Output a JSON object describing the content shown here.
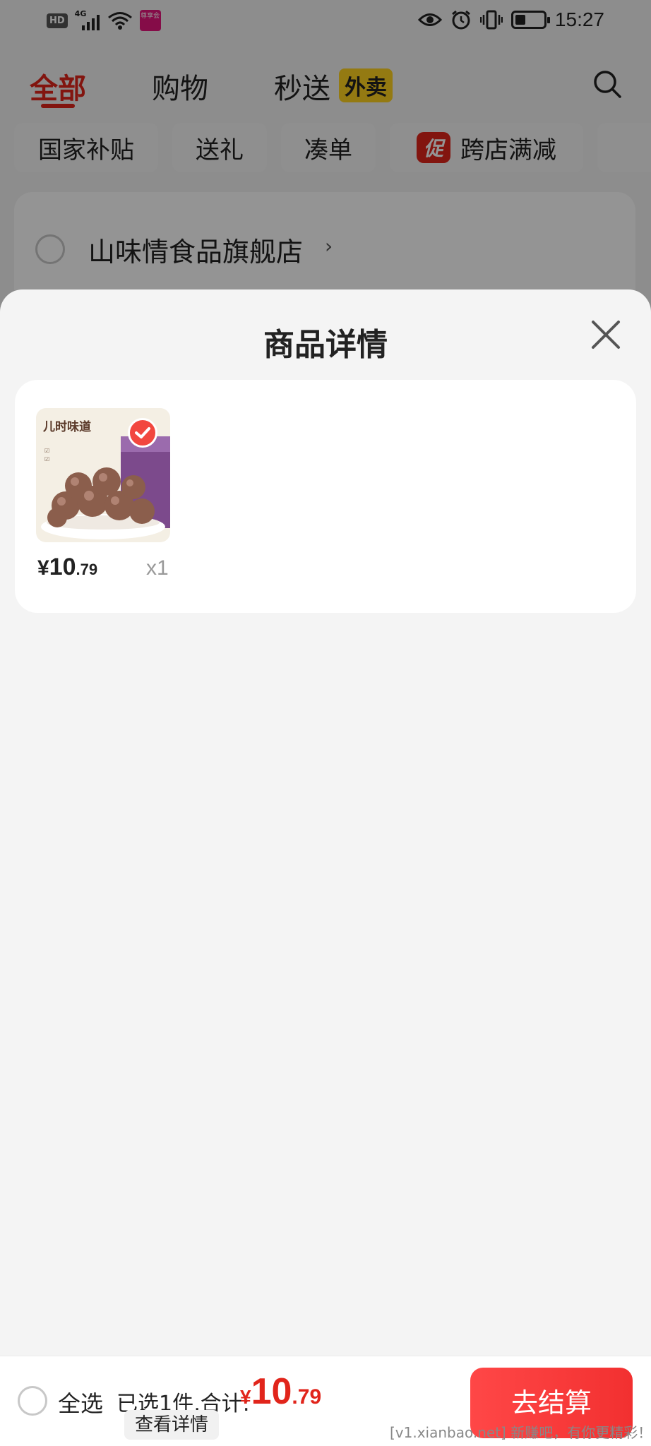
{
  "status_bar": {
    "hd": "HD",
    "network": "4G",
    "notification_app": "尊享会",
    "time": "15:27"
  },
  "top_tabs": [
    {
      "label": "全部",
      "active": true
    },
    {
      "label": "购物",
      "active": false
    },
    {
      "label": "秒送",
      "active": false
    }
  ],
  "waimai_badge": "外卖",
  "filter_chips": [
    "国家补贴",
    "送礼",
    "凑单",
    "跨店满减"
  ],
  "promo_tag": "促",
  "store": {
    "name": "山味情食品旗舰店",
    "chevron": "›"
  },
  "sheet": {
    "title": "商品详情",
    "item": {
      "image_title": "儿时味道",
      "price_yen": "¥",
      "price_int": "10",
      "price_dec": ".79",
      "qty": "x1"
    }
  },
  "bottom_bar": {
    "select_all": "全选",
    "summary": "已选1件,合计:",
    "total_yen": "¥",
    "total_int": "10",
    "total_dec": ".79",
    "detail_link": "查看详情",
    "checkout": "去结算"
  },
  "watermark": "[v1.xianbao.net] 新赚吧，有你更精彩！",
  "colors": {
    "accent": "#e1251b",
    "badge_yellow": "#ffd21f",
    "checkout": "#f23030"
  },
  "icons": [
    "signal-icon",
    "wifi-icon",
    "eye-icon",
    "alarm-icon",
    "vibrate-icon",
    "battery-icon",
    "search-icon",
    "close-icon",
    "check-icon"
  ]
}
